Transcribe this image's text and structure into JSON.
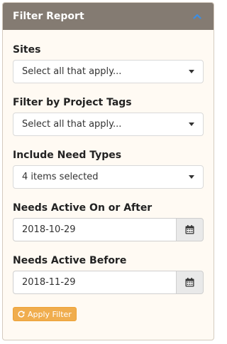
{
  "panel": {
    "title": "Filter Report"
  },
  "filters": {
    "sites": {
      "label": "Sites",
      "value": "Select all that apply..."
    },
    "project_tags": {
      "label": "Filter by Project Tags",
      "value": "Select all that apply..."
    },
    "need_types": {
      "label": "Include Need Types",
      "value": "4 items selected"
    },
    "active_on_or_after": {
      "label": "Needs Active On or After",
      "value": "2018-10-29"
    },
    "active_before": {
      "label": "Needs Active Before",
      "value": "2018-11-29"
    }
  },
  "actions": {
    "apply_label": "Apply Filter"
  },
  "colors": {
    "header_bg": "#847b72",
    "panel_bg": "#fffaf3",
    "accent_icon": "#3a8ee6",
    "apply_button": "#f0ad4e"
  },
  "icons": {
    "collapse": "chevron-up-icon",
    "dropdown": "caret-down-icon",
    "calendar": "calendar-icon",
    "apply": "refresh-icon"
  }
}
